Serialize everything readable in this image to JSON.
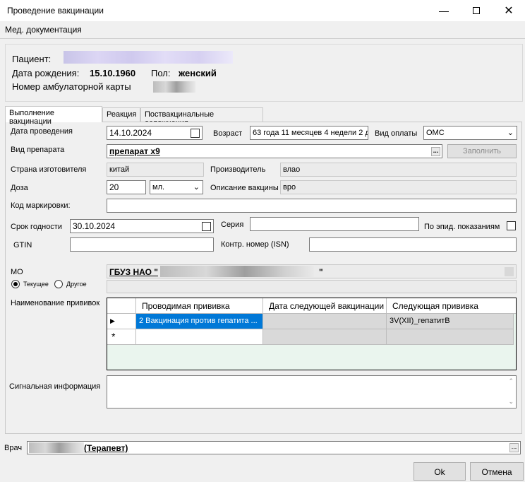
{
  "window": {
    "title": "Проведение вакцинации"
  },
  "menu": {
    "items": [
      "Мед. документация"
    ]
  },
  "patient": {
    "patient_label": "Пациент:",
    "birth_label": "Дата рождения:",
    "birth_value": "15.10.1960",
    "sex_label": "Пол:",
    "sex_value": "женский",
    "card_label": "Номер амбулаторной карты"
  },
  "tabs": [
    "Выполнение вакцинации",
    "Реакция",
    "Поствакцинальные осложнения"
  ],
  "form": {
    "date_label": "Дата проведения",
    "date_value": "14.10.2024",
    "age_label": "Возраст",
    "age_value": "63 года 11 месяцев 4 недели 2 д",
    "pay_label": "Вид оплаты",
    "pay_value": "ОМС",
    "drug_label": "Вид препарата",
    "drug_value": "препарат х9",
    "fill_button": "Заполнить",
    "country_label": "Страна изготовителя",
    "country_value": "китай",
    "maker_label": "Производитель",
    "maker_value": "влао",
    "dose_label": "Доза",
    "dose_value": "20",
    "unit_value": "мл.",
    "desc_label": "Описание вакцины",
    "desc_value": "вро",
    "marking_label": "Код маркировки:",
    "expiry_label": "Срок годности",
    "expiry_value": "30.10.2024",
    "series_label": "Серия",
    "epid_label": "По эпид. показаниям",
    "gtin_label": "GTIN",
    "control_label": "Контр. номер (ISN)",
    "mo_label": "МО",
    "mo_value": "ГБУЗ НАО \"",
    "mo_value_end": "\"",
    "radio_current": "Текущее",
    "radio_other": "Другое",
    "vacc_names_label": "Наименование прививок",
    "signal_label": "Сигнальная информация"
  },
  "grid": {
    "headers": [
      "Проводимая прививка",
      "Дата следующей вакцинации",
      "Следующая прививка"
    ],
    "rows": [
      [
        "2 Вакцинация против гепатита ...",
        "",
        "3V(XII)_гепатитB"
      ]
    ],
    "new_row_marker": "*",
    "current_row_marker": "▶"
  },
  "footer": {
    "doctor_label": "Врач",
    "doctor_value": "(Терапевт)",
    "ok_button": "Ok",
    "cancel_button": "Отмена"
  }
}
